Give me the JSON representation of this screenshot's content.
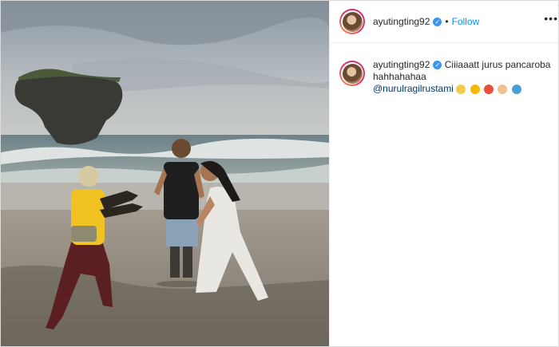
{
  "post": {
    "username": "ayutingting92",
    "follow_label": "Follow",
    "dot": "•",
    "more_label": "•••"
  },
  "caption": {
    "username": "ayutingting92",
    "text": "Ciiiaaatt jurus pancaroba hahhahahaa",
    "mention": "@nurulragilrustami",
    "emoji_icons": [
      "clapping-icon",
      "grinning-sweat-icon",
      "collision-icon",
      "punch-icon",
      "wave-icon"
    ]
  },
  "colors": {
    "follow": "#0095f6",
    "verified": "#3897f0",
    "mention": "#00376b"
  }
}
